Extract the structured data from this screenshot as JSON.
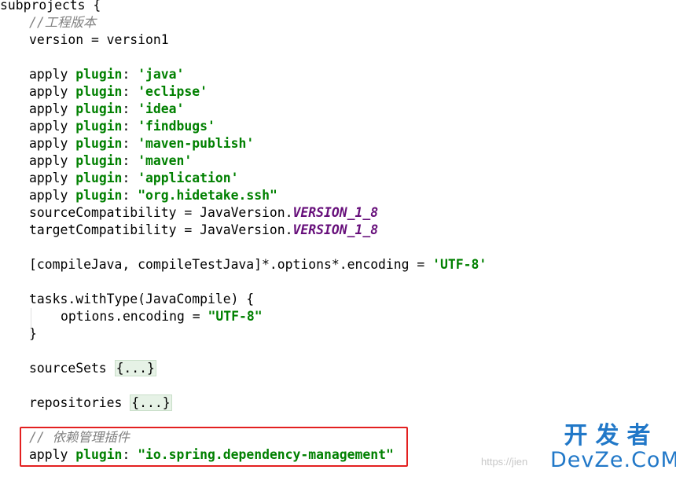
{
  "code": {
    "l1": "subprojects {",
    "l2_comment": "//工程版本",
    "l3": "version = version1",
    "plugins": [
      {
        "apply": "apply",
        "kw": "plugin",
        "colon": ": ",
        "value": "'java'"
      },
      {
        "apply": "apply",
        "kw": "plugin",
        "colon": ": ",
        "value": "'eclipse'"
      },
      {
        "apply": "apply",
        "kw": "plugin",
        "colon": ": ",
        "value": "'idea'"
      },
      {
        "apply": "apply",
        "kw": "plugin",
        "colon": ": ",
        "value": "'findbugs'"
      },
      {
        "apply": "apply",
        "kw": "plugin",
        "colon": ": ",
        "value": "'maven-publish'"
      },
      {
        "apply": "apply",
        "kw": "plugin",
        "colon": ": ",
        "value": "'maven'"
      },
      {
        "apply": "apply",
        "kw": "plugin",
        "colon": ": ",
        "value": "'application'"
      },
      {
        "apply": "apply",
        "kw": "plugin",
        "colon": ": ",
        "value": "\"org.hidetake.ssh\""
      }
    ],
    "source_compat_prefix": "sourceCompatibility = JavaVersion.",
    "target_compat_prefix": "targetCompatibility = JavaVersion.",
    "java_version_const": "VERSION_1_8",
    "encoding_prefix": "[compileJava, compileTestJava]*.options*.encoding = ",
    "encoding_value": "'UTF-8'",
    "tasks_line": "tasks.withType(JavaCompile) {",
    "options_prefix": "options.encoding = ",
    "options_value": "\"UTF-8\"",
    "close_brace": "}",
    "source_sets": "sourceSets ",
    "repositories": "repositories ",
    "folded": "{...}",
    "dep_comment": "// 依赖管理插件",
    "dep_apply": "apply",
    "dep_kw": "plugin",
    "dep_colon": ": ",
    "dep_value": "\"io.spring.dependency-management\""
  },
  "watermark": {
    "url": "https://jien",
    "logo_top": "开发者",
    "logo_bottom": "DevZe.CoM"
  },
  "colors": {
    "keyword": "#008000",
    "string": "#008000",
    "comment": "#808080",
    "constant": "#660e7a",
    "highlight_box": "#e32020",
    "logo": "#2178c8"
  }
}
